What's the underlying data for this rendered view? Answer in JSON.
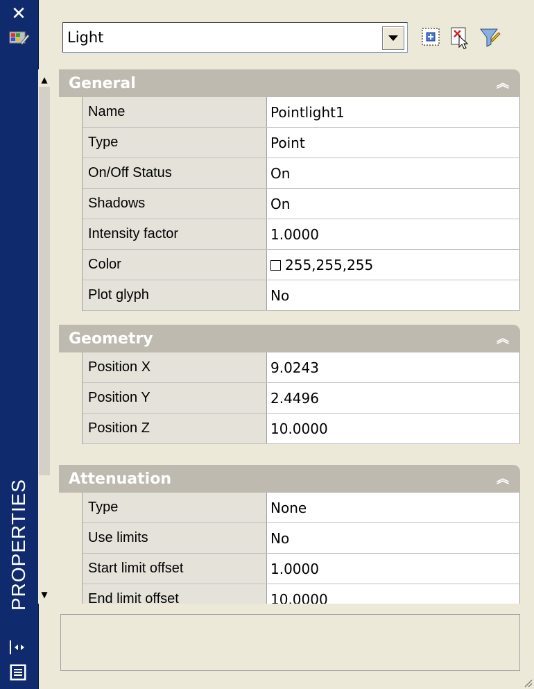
{
  "palette": {
    "title": "PROPERTIES",
    "selector_value": "Light"
  },
  "sections": [
    {
      "title": "General",
      "rows": [
        {
          "name": "Name",
          "value": "Pointlight1"
        },
        {
          "name": "Type",
          "value": "Point"
        },
        {
          "name": "On/Off Status",
          "value": "On"
        },
        {
          "name": "Shadows",
          "value": "On"
        },
        {
          "name": "Intensity factor",
          "value": "1.0000"
        },
        {
          "name": "Color",
          "value": "255,255,255"
        },
        {
          "name": "Plot glyph",
          "value": "No"
        }
      ]
    },
    {
      "title": "Geometry",
      "rows": [
        {
          "name": "Position X",
          "value": "9.0243"
        },
        {
          "name": "Position Y",
          "value": "2.4496"
        },
        {
          "name": "Position Z",
          "value": "10.0000"
        }
      ]
    },
    {
      "title": "Attenuation",
      "rows": [
        {
          "name": "Type",
          "value": "None"
        },
        {
          "name": "Use limits",
          "value": "No"
        },
        {
          "name": "Start limit offset",
          "value": "1.0000"
        },
        {
          "name": "End limit offset",
          "value": "10.0000"
        }
      ]
    }
  ],
  "colors": {
    "titlebar": "#0f2b6e",
    "section_header": "#bfbab0",
    "name_cell": "#e4e2d9"
  }
}
